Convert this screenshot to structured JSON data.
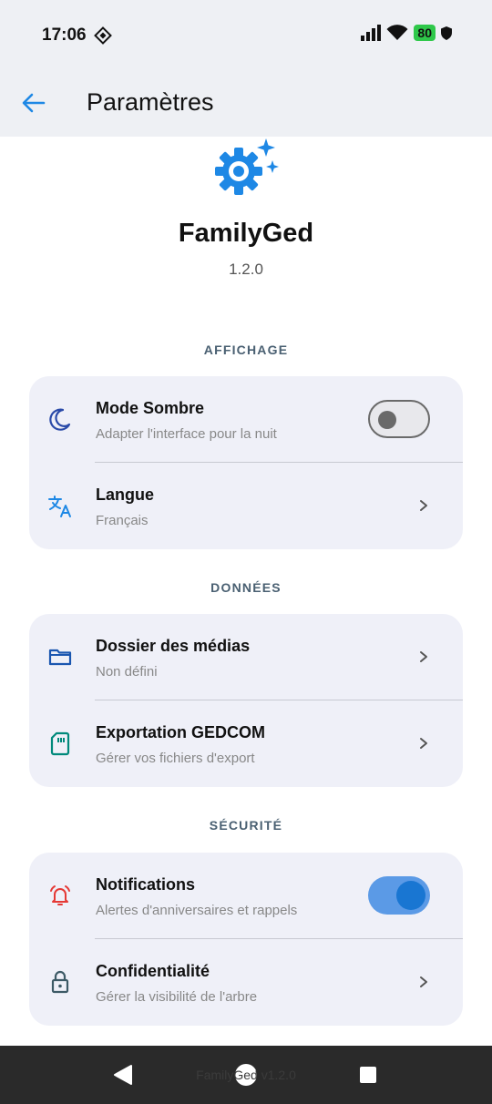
{
  "status_bar": {
    "time": "17:06",
    "battery": "80"
  },
  "header": {
    "title": "Paramètres"
  },
  "app_info": {
    "name": "FamilyGed",
    "version": "1.2.0"
  },
  "sections": {
    "display": {
      "title": "AFFICHAGE",
      "dark_mode": {
        "title": "Mode Sombre",
        "subtitle": "Adapter l'interface pour la nuit",
        "enabled": false
      },
      "language": {
        "title": "Langue",
        "subtitle": "Français"
      }
    },
    "data": {
      "title": "DONNÉES",
      "media_folder": {
        "title": "Dossier des médias",
        "subtitle": "Non défini"
      },
      "gedcom_export": {
        "title": "Exportation GEDCOM",
        "subtitle": "Gérer vos fichiers d'export"
      }
    },
    "security": {
      "title": "SÉCURITÉ",
      "notifications": {
        "title": "Notifications",
        "subtitle": "Alertes d'anniversaires et rappels",
        "enabled": true
      },
      "privacy": {
        "title": "Confidentialité",
        "subtitle": "Gérer la visibilité de l'arbre"
      }
    }
  },
  "footer": {
    "text": "FamilyGed v1.2.0"
  },
  "colors": {
    "accent": "#1e88e5",
    "card": "#eff0f8",
    "section_title": "#4a6072",
    "notification_icon": "#e53935",
    "export_icon": "#00897b"
  }
}
